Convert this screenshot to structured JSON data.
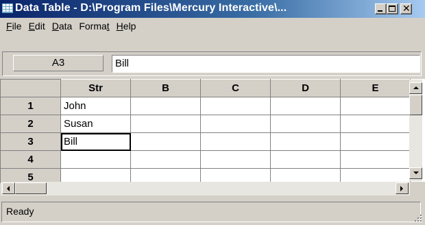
{
  "window": {
    "title": "Data Table - D:\\Program Files\\Mercury Interactive\\...",
    "icon": "grid-icon",
    "controls": {
      "minimize": "minimize-icon",
      "maximize": "maximize-icon",
      "close": "close-icon"
    }
  },
  "menu": {
    "items": [
      {
        "label": "File",
        "key": "F"
      },
      {
        "label": "Edit",
        "key": "E"
      },
      {
        "label": "Data",
        "key": "D"
      },
      {
        "label": "Format",
        "key": "t"
      },
      {
        "label": "Help",
        "key": "H"
      }
    ]
  },
  "formula": {
    "cell_ref": "A3",
    "cell_value": "Bill"
  },
  "grid": {
    "columns": [
      "Str",
      "B",
      "C",
      "D",
      "E"
    ],
    "rows": [
      {
        "num": "1",
        "cells": [
          "John",
          "",
          "",
          "",
          ""
        ]
      },
      {
        "num": "2",
        "cells": [
          "Susan",
          "",
          "",
          "",
          ""
        ]
      },
      {
        "num": "3",
        "cells": [
          "Bill",
          "",
          "",
          "",
          ""
        ]
      },
      {
        "num": "4",
        "cells": [
          "",
          "",
          "",
          "",
          ""
        ]
      },
      {
        "num": "5",
        "cells": [
          "",
          "",
          "",
          "",
          ""
        ]
      }
    ],
    "active_cell": "A3"
  },
  "status": {
    "text": "Ready"
  }
}
